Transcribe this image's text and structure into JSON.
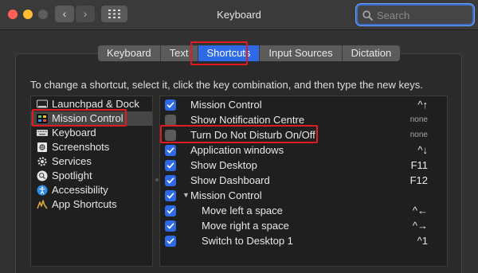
{
  "window": {
    "title": "Keyboard",
    "search_placeholder": "Search"
  },
  "tabs": [
    {
      "label": "Keyboard",
      "active": false
    },
    {
      "label": "Text",
      "active": false
    },
    {
      "label": "Shortcuts",
      "active": true
    },
    {
      "label": "Input Sources",
      "active": false
    },
    {
      "label": "Dictation",
      "active": false
    }
  ],
  "instructions": "To change a shortcut, select it, click the key combination, and then type the new keys.",
  "categories": [
    {
      "label": "Launchpad & Dock",
      "icon": "launchpad-dock-icon",
      "selected": false
    },
    {
      "label": "Mission Control",
      "icon": "mission-control-icon",
      "selected": true
    },
    {
      "label": "Keyboard",
      "icon": "keyboard-icon",
      "selected": false
    },
    {
      "label": "Screenshots",
      "icon": "screenshots-icon",
      "selected": false
    },
    {
      "label": "Services",
      "icon": "services-gear-icon",
      "selected": false
    },
    {
      "label": "Spotlight",
      "icon": "spotlight-icon",
      "selected": false
    },
    {
      "label": "Accessibility",
      "icon": "accessibility-icon",
      "selected": false
    },
    {
      "label": "App Shortcuts",
      "icon": "app-shortcuts-icon",
      "selected": false
    }
  ],
  "shortcuts": [
    {
      "label": "Mission Control",
      "checked": true,
      "key": "^↑",
      "indent": 0,
      "group": false
    },
    {
      "label": "Show Notification Centre",
      "checked": false,
      "key": "none",
      "indent": 0,
      "group": false
    },
    {
      "label": "Turn Do Not Disturb On/Off",
      "checked": false,
      "key": "none",
      "indent": 0,
      "group": false
    },
    {
      "label": "Application windows",
      "checked": true,
      "key": "^↓",
      "indent": 0,
      "group": false
    },
    {
      "label": "Show Desktop",
      "checked": true,
      "key": "F11",
      "indent": 0,
      "group": false
    },
    {
      "label": "Show Dashboard",
      "checked": true,
      "key": "F12",
      "indent": 0,
      "group": false
    },
    {
      "label": "Mission Control",
      "checked": true,
      "key": "",
      "indent": 0,
      "group": true
    },
    {
      "label": "Move left a space",
      "checked": true,
      "key": "^←",
      "indent": 1,
      "group": false
    },
    {
      "label": "Move right a space",
      "checked": true,
      "key": "^→",
      "indent": 1,
      "group": false
    },
    {
      "label": "Switch to Desktop 1",
      "checked": true,
      "key": "^1",
      "indent": 1,
      "group": false
    }
  ],
  "colors": {
    "accent": "#2f6ae6",
    "highlight_box": "#e21b23"
  }
}
